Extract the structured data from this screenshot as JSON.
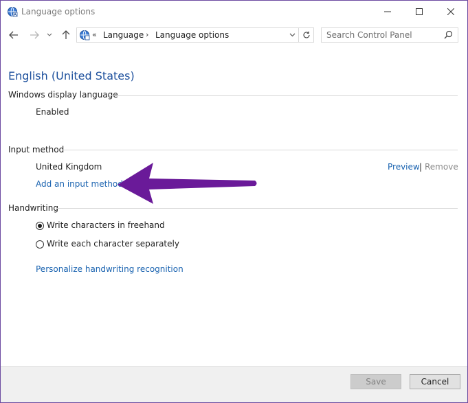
{
  "window": {
    "title": "Language options",
    "icon": "language-globe-icon"
  },
  "nav": {
    "breadcrumb_overflow": "«",
    "crumbs": [
      "Language",
      "Language options"
    ],
    "crumb_separator": "›",
    "search_placeholder": "Search Control Panel"
  },
  "main": {
    "heading": "English (United States)",
    "display_language": {
      "title": "Windows display language",
      "status": "Enabled"
    },
    "input_method": {
      "title": "Input method",
      "item": "United Kingdom",
      "preview_link": "Preview",
      "separator": "|",
      "remove_link": "Remove",
      "add_link": "Add an input method"
    },
    "handwriting": {
      "title": "Handwriting",
      "options": [
        {
          "label": "Write characters in freehand",
          "selected": true
        },
        {
          "label": "Write each character separately",
          "selected": false
        }
      ],
      "personalize_link": "Personalize handwriting recognition"
    }
  },
  "annotation": {
    "arrow_color": "#6a1a99"
  },
  "footer": {
    "save_label": "Save",
    "cancel_label": "Cancel"
  },
  "colors": {
    "link": "#1a63b0",
    "heading": "#1c4f9c",
    "window_border": "#6b4aa0"
  }
}
